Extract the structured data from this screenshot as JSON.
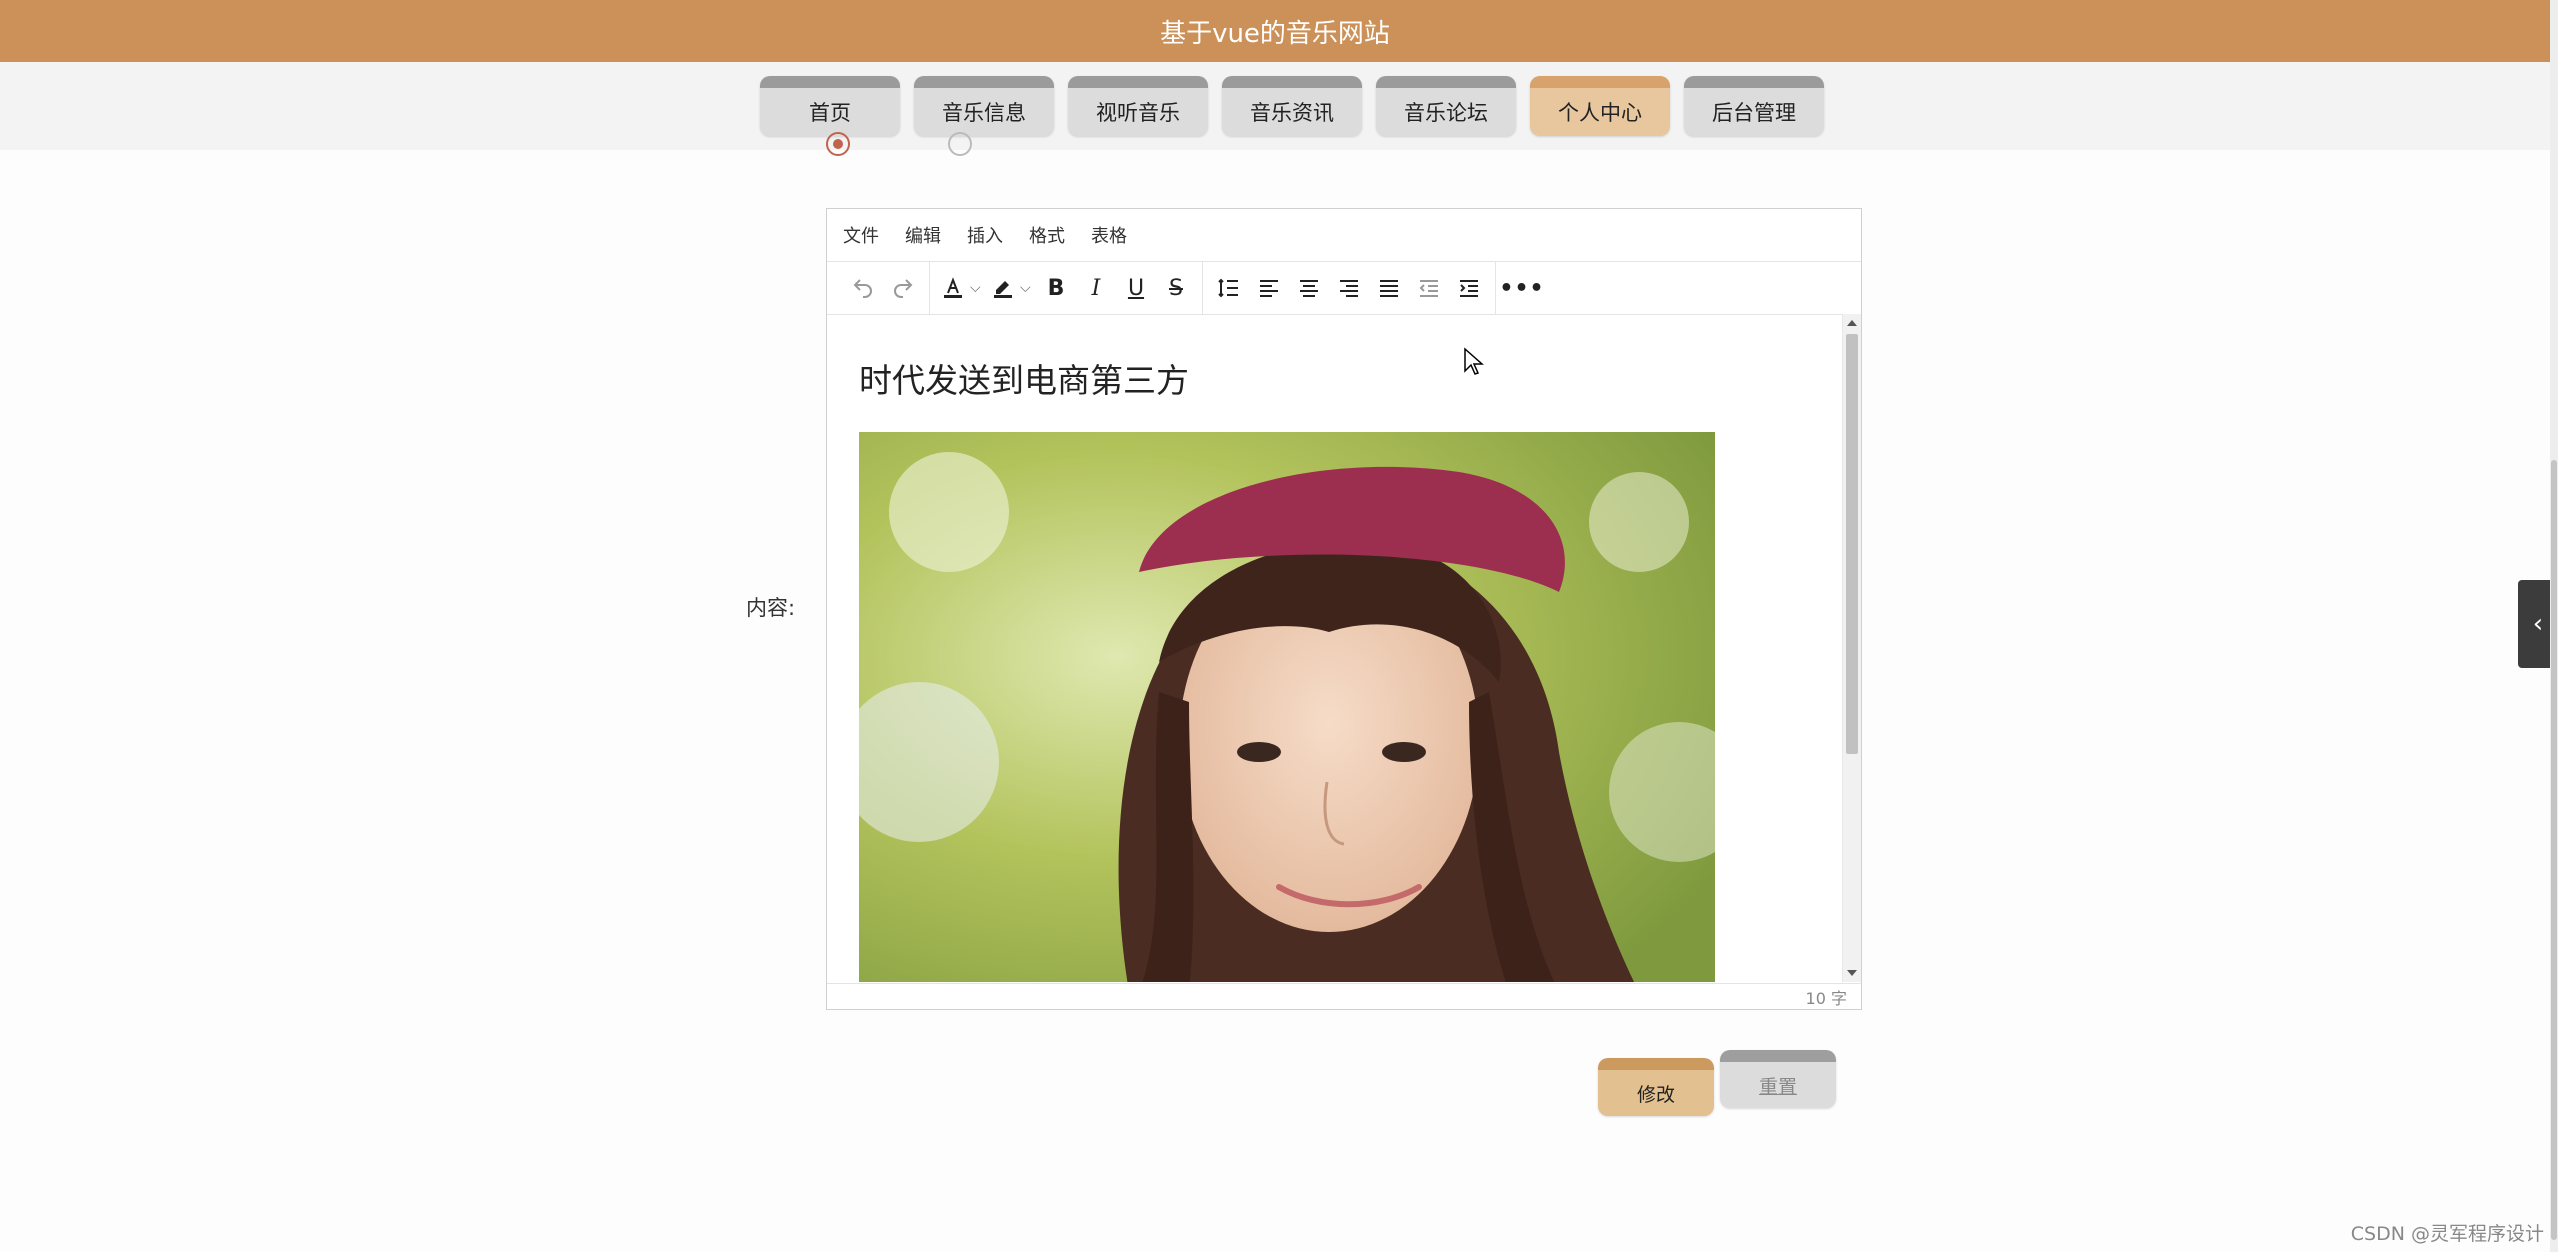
{
  "header": {
    "title": "基于vue的音乐网站"
  },
  "nav": {
    "tabs": [
      {
        "label": "首页",
        "active": false
      },
      {
        "label": "音乐信息",
        "active": false
      },
      {
        "label": "视听音乐",
        "active": false
      },
      {
        "label": "音乐资讯",
        "active": false
      },
      {
        "label": "音乐论坛",
        "active": false
      },
      {
        "label": "个人中心",
        "active": true
      },
      {
        "label": "后台管理",
        "active": false
      }
    ]
  },
  "form": {
    "content_label": "内容:",
    "modify_label": "修改",
    "reset_label": "重置"
  },
  "editor": {
    "menu": [
      "文件",
      "编辑",
      "插入",
      "格式",
      "表格"
    ],
    "toolbar_icons": [
      "undo-icon",
      "redo-icon",
      "font-color-icon",
      "highlight-icon",
      "bold-icon",
      "italic-icon",
      "underline-icon",
      "strikethrough-icon",
      "line-height-icon",
      "align-left-icon",
      "align-center-icon",
      "align-right-icon",
      "align-justify-icon",
      "outdent-icon",
      "indent-icon",
      "more-icon"
    ],
    "heading": "时代发送到电商第三方",
    "word_count": "10 字"
  },
  "colors": {
    "header_bg": "#cb9158",
    "active_tab": "#e8c79e",
    "tab": "#dcdcdc"
  },
  "watermark": "CSDN @灵军程序设计"
}
